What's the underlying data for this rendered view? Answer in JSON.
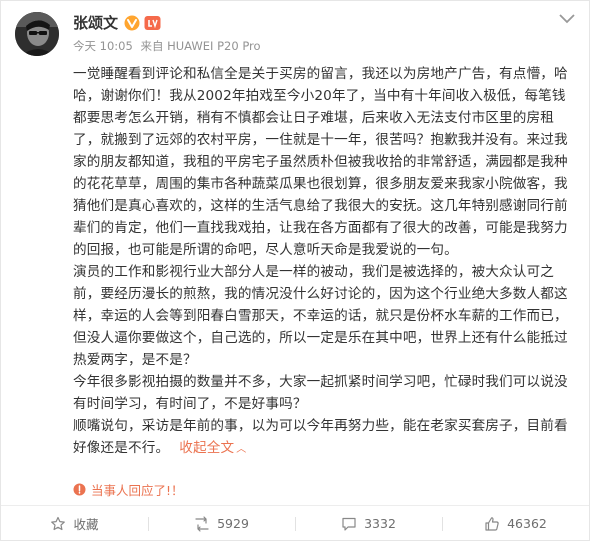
{
  "post": {
    "author": "张颂文",
    "time": "今天 10:05",
    "source": "来自 HUAWEI P20 Pro",
    "paragraphs": [
      "一觉睡醒看到评论和私信全是关于买房的留言，我还以为房地产广告，有点懵，哈哈，谢谢你们！我从2002年拍戏至今小20年了，当中有十年间收入极低，每笔钱都要思考怎么开销，稍有不慎都会让日子难堪，后来收入无法支付市区里的房租了，就搬到了远郊的农村平房，一住就是十一年，很苦吗？抱歉我并没有。来过我家的朋友都知道，我租的平房宅子虽然质朴但被我收拾的非常舒适，满园都是我种的花花草草，周围的集市各种蔬菜瓜果也很划算，很多朋友爱来我家小院做客，我猜他们是真心喜欢的，这样的生活气息给了我很大的安抚。这几年特别感谢同行前辈们的肯定，他们一直找我戏拍，让我在各方面都有了很大的改善，可能是我努力的回报，也可能是所谓的命吧，尽人意听天命是我爱说的一句。",
      "演员的工作和影视行业大部分人是一样的被动，我们是被选择的，被大众认可之前，要经历漫长的煎熬，我的情况没什么好讨论的，因为这个行业绝大多数人都这样，幸运的人会等到阳春白雪那天，不幸运的话，就只是份杯水车薪的工作而已，但没人逼你要做这个，自己选的，所以一定是乐在其中吧，世界上还有什么能抵过热爱两字，是不是？",
      "今年很多影视拍摄的数量并不多，大家一起抓紧时间学习吧，忙碌时我们可以说没有时间学习，有时间了，不是好事吗？",
      "顺嘴说句，采访是年前的事，以为可以今年再努力些，能在老家买套房子，目前看好像还是不行。"
    ],
    "collapse_label": "收起全文",
    "collapse_arrow": "︿",
    "reply_note": "当事人回应了!！"
  },
  "footer": {
    "favorite_label": "收藏",
    "repost_count": "5929",
    "comment_count": "3332",
    "like_count": "46362"
  },
  "colors": {
    "accent": "#eb7350",
    "verified": "#ffa52f",
    "meta": "#939393"
  },
  "icons": {
    "verified": "verified-v-icon",
    "level": "level-badge-icon",
    "menu": "chevron-down-icon",
    "reply": "reply-note-icon",
    "favorite": "star-icon",
    "repost": "repost-icon",
    "comment": "comment-icon",
    "like": "thumbs-up-icon"
  }
}
